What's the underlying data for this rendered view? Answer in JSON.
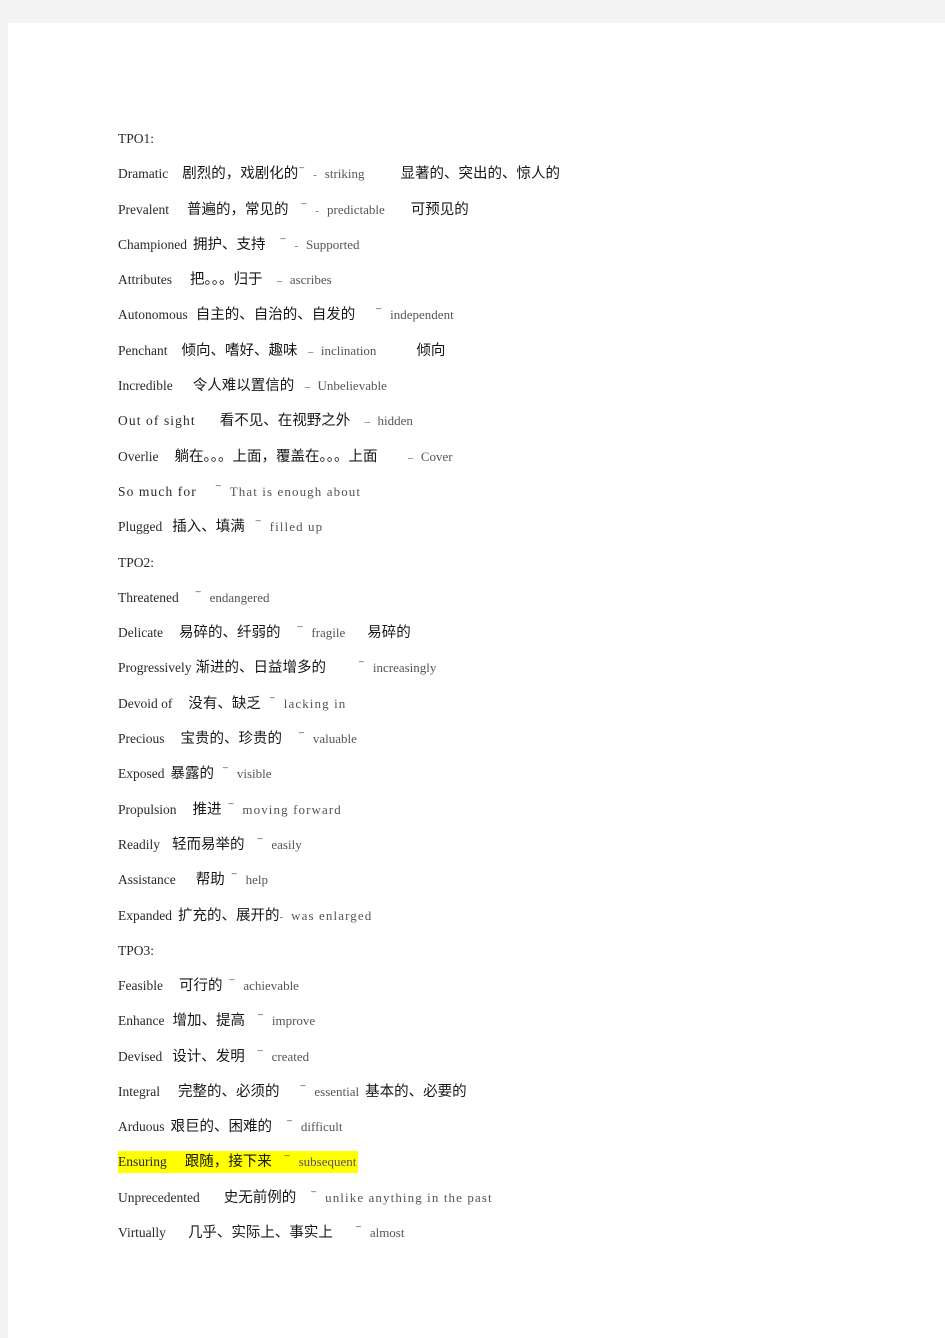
{
  "document": {
    "title": "TPO Vocabulary Notes",
    "highlight_color": "#ffff00",
    "page_background": "#ffffff",
    "canvas_background": "#f4f4f4"
  },
  "sections": [
    {
      "heading": "TPO1:",
      "entries": [
        {
          "word": "Dramatic",
          "chinese": "剧烈的，戏剧化的",
          "dash1": "⁻",
          "dash2": "-",
          "synonym": "striking",
          "chinese2": "显著的、突出的、惊人的"
        },
        {
          "word": "Prevalent",
          "chinese": "普遍的，常见的",
          "dash1": "⁻",
          "dash2": "-",
          "synonym": "predictable",
          "chinese2": "可预见的"
        },
        {
          "word": "Championed",
          "chinese": "拥护、支持",
          "dash1": "⁻",
          "dash2": "-",
          "synonym": "Supported",
          "chinese2": ""
        },
        {
          "word": "Attributes",
          "chinese": "把。。。归于",
          "dash1": "",
          "dash2": "--",
          "synonym": "ascribes",
          "chinese2": ""
        },
        {
          "word": "Autonomous",
          "chinese": "自主的、自治的、自发的",
          "dash1": "⁻",
          "dash2": "",
          "synonym": "independent",
          "chinese2": ""
        },
        {
          "word": "Penchant",
          "chinese": "倾向、嗜好、趣味",
          "dash1": "",
          "dash2": "--",
          "synonym": "inclination",
          "chinese2": "倾向"
        },
        {
          "word": "Incredible",
          "chinese": "令人难以置信的",
          "dash1": "",
          "dash2": "--",
          "synonym": "Unbelievable",
          "chinese2": ""
        },
        {
          "word": "Out of sight",
          "chinese": "看不见、在视野之外",
          "dash1": "",
          "dash2": "--",
          "synonym": "hidden",
          "chinese2": ""
        },
        {
          "word": "Overlie",
          "chinese": "躺在。。。上面，覆盖在。。。上面",
          "dash1": "",
          "dash2": "--",
          "synonym": "Cover",
          "chinese2": ""
        },
        {
          "word": "So much for",
          "chinese": "",
          "dash1": "⁻",
          "dash2": "",
          "synonym": "That is enough about",
          "chinese2": ""
        },
        {
          "word": "Plugged",
          "chinese": "插入、填满",
          "dash1": "⁻",
          "dash2": "",
          "synonym": "filled up",
          "chinese2": ""
        }
      ]
    },
    {
      "heading": "TPO2:",
      "entries": [
        {
          "word": "Threatened",
          "chinese": "",
          "dash1": "⁻",
          "dash2": "",
          "synonym": "endangered",
          "chinese2": ""
        },
        {
          "word": "Delicate",
          "chinese": "易碎的、纤弱的",
          "dash1": "⁻",
          "dash2": "",
          "synonym": "fragile",
          "chinese2": "易碎的"
        },
        {
          "word": "Progressively",
          "chinese": "渐进的、日益增多的",
          "dash1": "⁻",
          "dash2": "",
          "synonym": "increasingly",
          "chinese2": ""
        },
        {
          "word": "Devoid of",
          "chinese": "没有、缺乏",
          "dash1": "⁻",
          "dash2": "",
          "synonym": "lacking in",
          "chinese2": ""
        },
        {
          "word": "Precious",
          "chinese": "宝贵的、珍贵的",
          "dash1": "⁻",
          "dash2": "",
          "synonym": "valuable",
          "chinese2": ""
        },
        {
          "word": "Exposed",
          "chinese": "暴露的",
          "dash1": "⁻",
          "dash2": "",
          "synonym": "visible",
          "chinese2": ""
        },
        {
          "word": "Propulsion",
          "chinese": "推进",
          "dash1": "⁻",
          "dash2": "",
          "synonym": "moving forward",
          "chinese2": ""
        },
        {
          "word": "Readily",
          "chinese": "轻而易举的",
          "dash1": "⁻",
          "dash2": "",
          "synonym": "easily",
          "chinese2": ""
        },
        {
          "word": "Assistance",
          "chinese": "帮助",
          "dash1": "⁻",
          "dash2": "",
          "synonym": "help",
          "chinese2": ""
        },
        {
          "word": "Expanded",
          "chinese": "扩充的、展开的",
          "dash1": "-",
          "dash2": "",
          "synonym": "was enlarged",
          "chinese2": ""
        }
      ]
    },
    {
      "heading": "TPO3:",
      "entries": [
        {
          "word": "Feasible",
          "chinese": "可行的",
          "dash1": "⁻",
          "dash2": "",
          "synonym": "achievable",
          "chinese2": ""
        },
        {
          "word": "Enhance",
          "chinese": "增加、提高",
          "dash1": "⁻",
          "dash2": "",
          "synonym": "improve",
          "chinese2": ""
        },
        {
          "word": "Devised",
          "chinese": "设计、发明",
          "dash1": "⁻",
          "dash2": "",
          "synonym": "created",
          "chinese2": ""
        },
        {
          "word": "Integral",
          "chinese": "完整的、必须的",
          "dash1": "⁻",
          "dash2": "",
          "synonym": "essential",
          "chinese2": "基本的、必要的"
        },
        {
          "word": "Arduous",
          "chinese": "艰巨的、困难的",
          "dash1": "⁻",
          "dash2": "",
          "synonym": "difficult",
          "chinese2": ""
        },
        {
          "word": "Ensuring",
          "chinese": "跟随，接下来",
          "dash1": "⁻",
          "dash2": "",
          "synonym": "subsequent",
          "chinese2": "",
          "highlighted": true
        },
        {
          "word": "Unprecedented",
          "chinese": "史无前例的",
          "dash1": "⁻",
          "dash2": "",
          "synonym": "unlike anything in the past",
          "chinese2": ""
        },
        {
          "word": "Virtually",
          "chinese": "几乎、实际上、事实上",
          "dash1": "⁻",
          "dash2": "",
          "synonym": "almost",
          "chinese2": ""
        }
      ]
    }
  ]
}
